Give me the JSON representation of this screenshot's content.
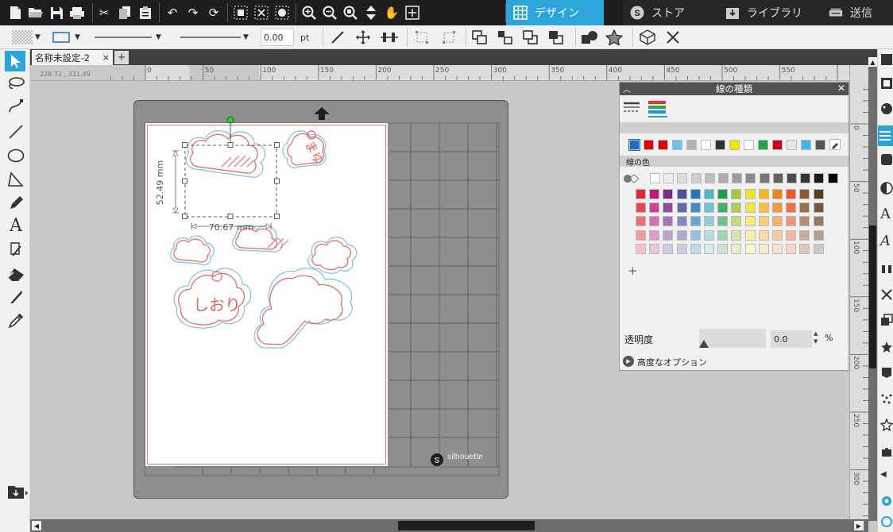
{
  "toolbar": {
    "icons": [
      "new-document-icon",
      "open-folder-icon",
      "save-icon",
      "print-icon",
      "cut-icon",
      "copy-icon",
      "paste-icon",
      "undo-icon",
      "redo-icon",
      "refresh-icon",
      "group-icon",
      "ungroup-icon",
      "palette-icon",
      "zoom-in-icon",
      "zoom-out-icon",
      "zoom-select-icon",
      "move-arrows-icon",
      "hand-icon",
      "fit-page-icon"
    ]
  },
  "nav": {
    "design": "デザイン",
    "store": "ストア",
    "library": "ライブラリ",
    "send": "送信",
    "active_color": "#2ba5d9"
  },
  "options": {
    "line_width_value": "0.00",
    "line_width_unit": "pt"
  },
  "document": {
    "tab_name": "名称未設定-2",
    "tab_close": "×",
    "add_tab": "+",
    "cursor_readout": "228.72 , 331.49"
  },
  "ruler": {
    "h_labels": [
      "0",
      "50",
      "100",
      "150",
      "200",
      "250",
      "300",
      "350",
      "400",
      "450",
      "500",
      "550"
    ],
    "v_labels": [
      "0",
      "50",
      "100",
      "150",
      "200",
      "250",
      "300"
    ]
  },
  "canvas": {
    "selection_height": "52.49 mm",
    "selection_width": "70.67 mm",
    "shape_text_1": "しおり",
    "shape_text_2": "まゆ",
    "brand": "silhouette"
  },
  "panel": {
    "title": "線の種類",
    "section_label": "線の色",
    "transparency_label": "透明度",
    "transparency_value": "0.0",
    "transparency_unit": "%",
    "advanced_label": "高度なオプション",
    "add_symbol": "+",
    "recent_colors": [
      "#1e6fb8",
      "#e00000",
      "#e00000",
      "#6ec4e8",
      "#b4b4b4",
      "#ffffff",
      "#333333",
      "#f3e600",
      "#ffffff",
      "#23a34a",
      "#c8001e",
      "#e6e6e6",
      "#3cb8e6",
      "#555555"
    ],
    "grays": [
      "#ffffff",
      "#eeeeee",
      "#dedede",
      "#cecece",
      "#bebebe",
      "#aeaeae",
      "#9e9e9e",
      "#8a8a8a",
      "#767676",
      "#626262",
      "#4c4c4c",
      "#363636",
      "#1e1e1e",
      "#000000"
    ],
    "palette_rows": [
      [
        "#e8262e",
        "#c4177a",
        "#7a2d8c",
        "#4b4fa5",
        "#1f78c0",
        "#52b8c4",
        "#1e9f4b",
        "#a6c73b",
        "#f1e31c",
        "#f6b51b",
        "#f08320",
        "#e85927",
        "#8a5a2e",
        "#5b3a1e"
      ],
      [
        "#ec4750",
        "#cd428f",
        "#8d4c9e",
        "#6468b1",
        "#3c8cc9",
        "#6cc3cd",
        "#46ad66",
        "#b3cf59",
        "#f3e649",
        "#f7c145",
        "#f29745",
        "#ec7349",
        "#9c7150",
        "#755641"
      ],
      [
        "#f06f76",
        "#d76fa8",
        "#a575b3",
        "#8689c2",
        "#69a6d5",
        "#8fd0d7",
        "#72c08b",
        "#c4da81",
        "#f6ec7a",
        "#f9cf75",
        "#f5b074",
        "#f19577",
        "#b28e74",
        "#947a68"
      ],
      [
        "#f4999e",
        "#e29bc3",
        "#bea0ca",
        "#aaacd3",
        "#96c1e1",
        "#b3dee3",
        "#9fd3b2",
        "#d6e5a8",
        "#f8f2a6",
        "#fbdda3",
        "#f8c9a3",
        "#f5b6a3",
        "#c8ab98",
        "#b3a092"
      ],
      [
        "#f8c3c6",
        "#edc4dc",
        "#d8c9e0",
        "#cdcee4",
        "#c1dbee",
        "#d5ecf0",
        "#c8e6d3",
        "#e6efcd",
        "#fbf7ce",
        "#fdeccc",
        "#fbe0cc",
        "#f9d5cc",
        "#ddc8bb",
        "#d2c6bd"
      ]
    ]
  }
}
